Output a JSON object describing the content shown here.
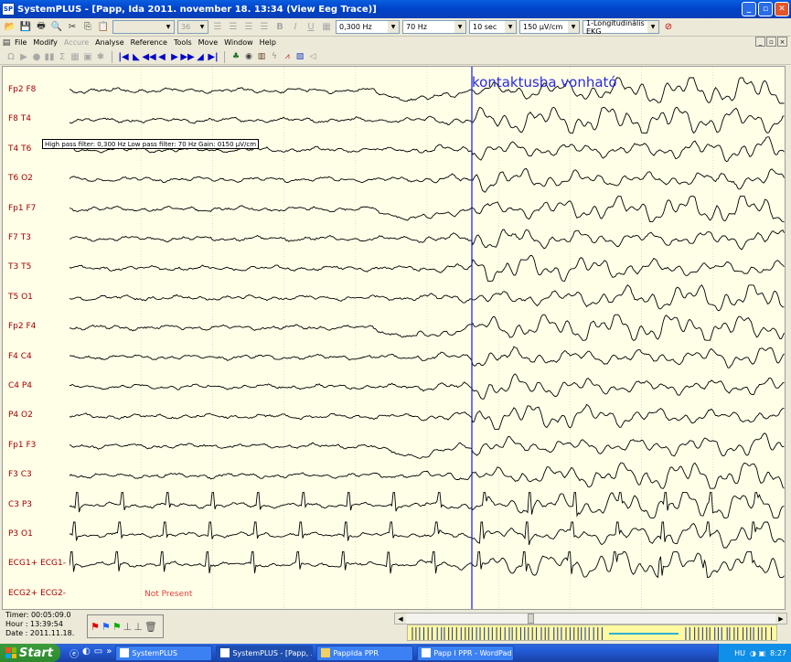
{
  "window": {
    "title": "SystemPLUS - [Papp, Ida 2011. november 18. 13:34 (View Eeg Trace)]",
    "app_icon": "SP"
  },
  "toolbar1": {
    "font_combo": "",
    "size_combo": "36",
    "highpass": "0,300 Hz",
    "lowpass": "70 Hz",
    "timebase": "10 sec",
    "gain": "150 µV/cm",
    "montage": "1-Longitudinális EKG"
  },
  "menu": [
    "File",
    "Modify",
    "Accure",
    "Analyse",
    "Reference",
    "Tools",
    "Move",
    "Window",
    "Help"
  ],
  "channels": [
    "Fp2 F8",
    "F8 T4",
    "T4 T6",
    "T6 O2",
    "Fp1 F7",
    "F7 T3",
    "T3 T5",
    "T5 O1",
    "Fp2 F4",
    "F4 C4",
    "C4 P4",
    "P4 O2",
    "Fp1 F3",
    "F3 C3",
    "C3 P3",
    "P3 O1",
    "ECG1+ ECG1-",
    "ECG2+ ECG2-"
  ],
  "annotation": "kontaktusba vonható",
  "filter_info": "High pass filter: 0,300 Hz    Low pass filter: 70 Hz    Gain: 0150 µV/cm",
  "not_present": "Not Present",
  "status": {
    "timer": "Timer: 00:05:09.0",
    "hour": "Hour : 13:39:54",
    "date": "Date : 2011.11.18."
  },
  "taskbar": {
    "start": "Start",
    "tasks": [
      "SystemPLUS",
      "SystemPLUS - [Papp, ...",
      "PappIda PPR",
      "Papp I PPR - WordPad"
    ],
    "tray_lang": "HU",
    "clock": "8:27"
  },
  "colors": {
    "trace": "#000000",
    "label": "#a00000",
    "marker": "#1a1ad8",
    "annotation": "#2a2adf",
    "background": "#ffffe8"
  }
}
